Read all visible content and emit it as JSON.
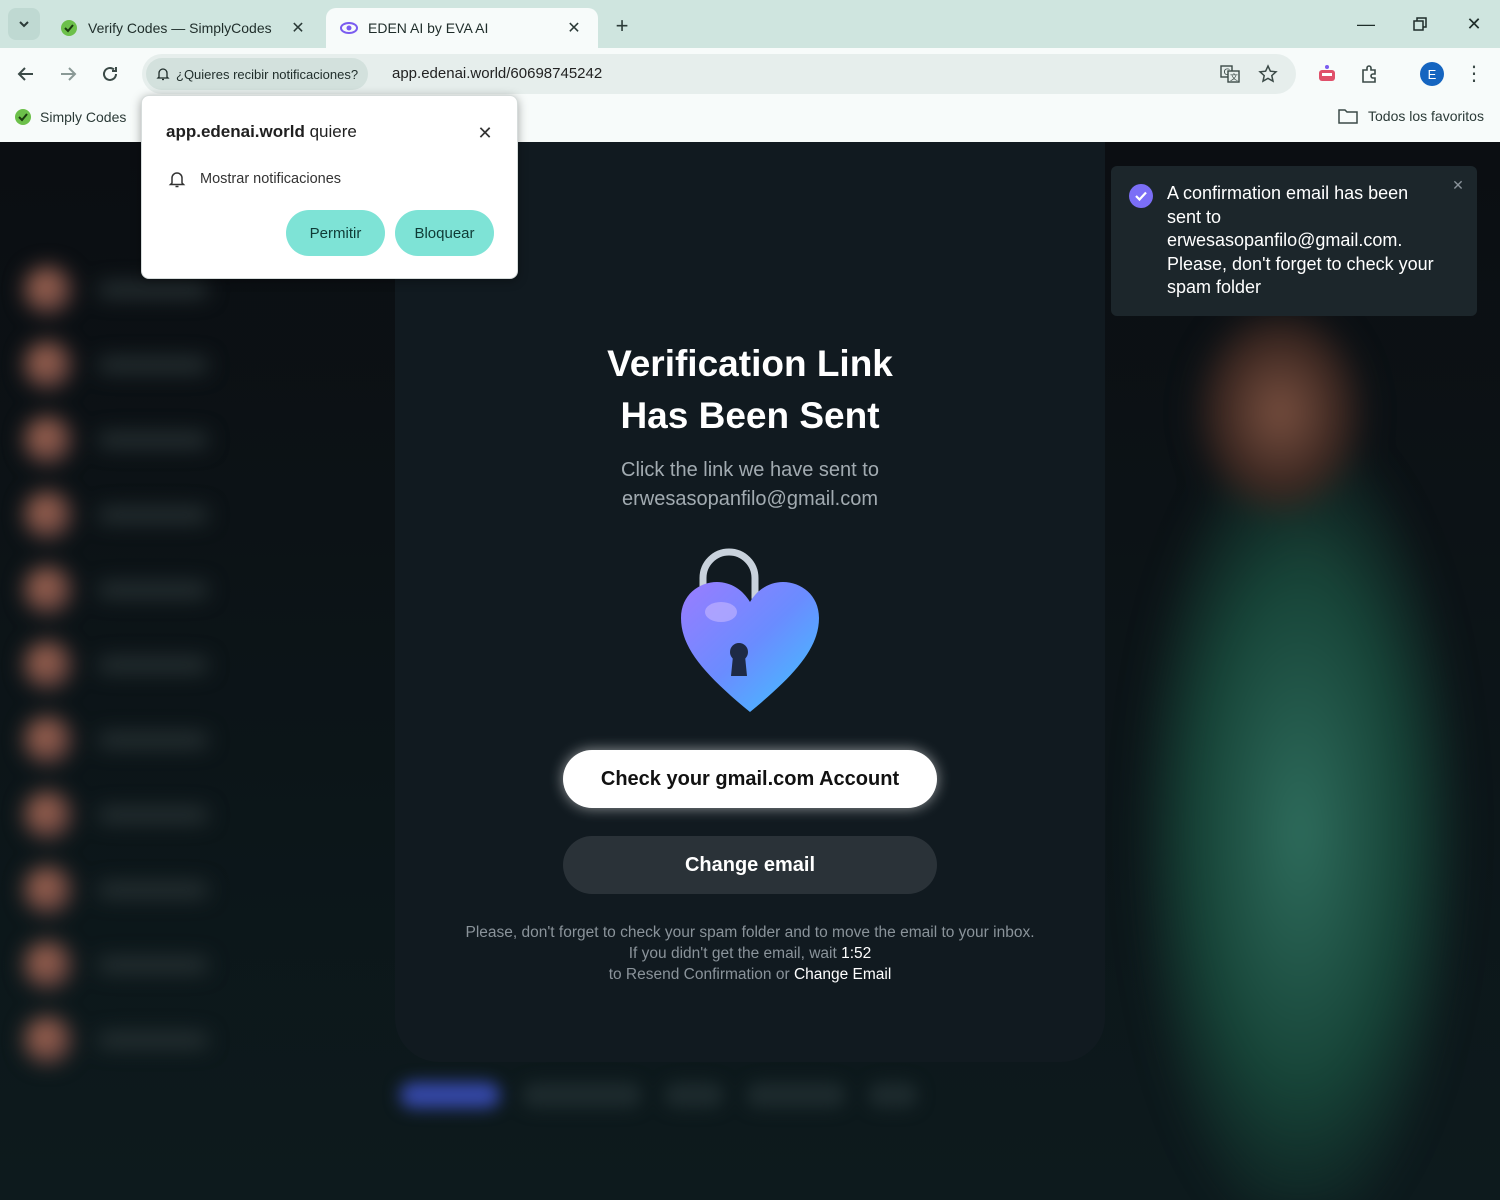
{
  "tabs": [
    {
      "title": "Verify Codes — SimplyCodes",
      "favicon": "simplycodes-icon"
    },
    {
      "title": "EDEN AI by EVA AI",
      "favicon": "eye-icon"
    }
  ],
  "address_bar": {
    "notification_chip": "¿Quieres recibir notificaciones?",
    "url": "app.edenai.world/60698745242"
  },
  "bookmarks": {
    "items": [
      {
        "label": "Simply Codes"
      }
    ],
    "all_bookmarks": "Todos los favoritos"
  },
  "profile_initial": "E",
  "permission_popup": {
    "site": "app.edenai.world",
    "wants": " quiere",
    "permission": "Mostrar notificaciones",
    "allow": "Permitir",
    "block": "Bloquear"
  },
  "toast": {
    "message": "A confirmation email has been sent to erwesasopanfilo@gmail.com. Please, don't forget to check your spam folder"
  },
  "card": {
    "heading_line1": "Verification Link",
    "heading_line2": "Has Been Sent",
    "subtitle_line1": "Click the link we have sent to",
    "subtitle_email": "erwesasopanfilo@gmail.com",
    "check_button": "Check your gmail.com Account",
    "change_button": "Change email",
    "footnote_line1": "Please, don't forget to check your spam folder and to move the email to your inbox.",
    "footnote_wait_prefix": "If you didn't get the email, wait ",
    "countdown": "1:52",
    "footnote_resend": "to Resend Confirmation or ",
    "change_email_link": "Change Email"
  },
  "colors": {
    "accent_button": "#7ee3d6",
    "toast_check": "#7b6ef6",
    "card_bg": "#111a20"
  }
}
